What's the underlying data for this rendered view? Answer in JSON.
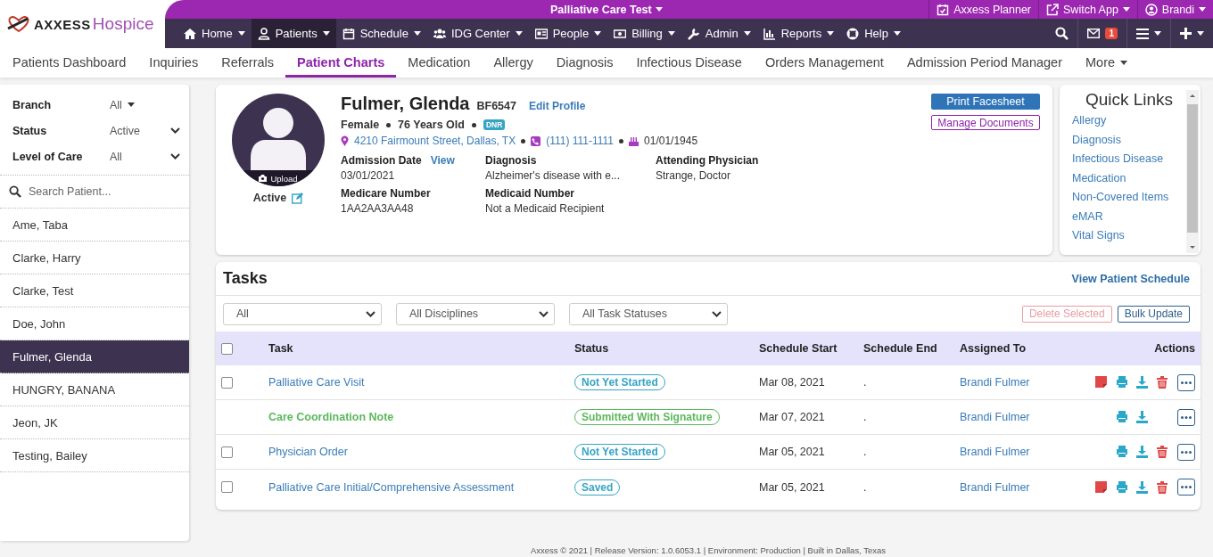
{
  "header": {
    "logo": {
      "brand": "AXXESS",
      "product": "Hospice"
    },
    "context_title": "Palliative Care Test",
    "top_links": [
      {
        "label": "Axxess Planner",
        "has_caret": false
      },
      {
        "label": "Switch App",
        "has_caret": true
      },
      {
        "label": "Brandi",
        "has_caret": true
      }
    ],
    "nav": [
      {
        "label": "Home",
        "selected": false
      },
      {
        "label": "Patients",
        "selected": true
      },
      {
        "label": "Schedule",
        "selected": false
      },
      {
        "label": "IDG Center",
        "selected": false
      },
      {
        "label": "People",
        "selected": false
      },
      {
        "label": "Billing",
        "selected": false
      },
      {
        "label": "Admin",
        "selected": false
      },
      {
        "label": "Reports",
        "selected": false
      },
      {
        "label": "Help",
        "selected": false
      }
    ],
    "message_count": "1"
  },
  "subnav": [
    {
      "label": "Patients Dashboard",
      "selected": false
    },
    {
      "label": "Inquiries",
      "selected": false
    },
    {
      "label": "Referrals",
      "selected": false
    },
    {
      "label": "Patient Charts",
      "selected": true
    },
    {
      "label": "Medication",
      "selected": false
    },
    {
      "label": "Allergy",
      "selected": false
    },
    {
      "label": "Diagnosis",
      "selected": false
    },
    {
      "label": "Infectious Disease",
      "selected": false
    },
    {
      "label": "Orders Management",
      "selected": false
    },
    {
      "label": "Admission Period Manager",
      "selected": false
    },
    {
      "label": "More",
      "selected": false
    }
  ],
  "sidebar": {
    "filters": [
      {
        "label": "Branch",
        "value": "All",
        "kind": "menu"
      },
      {
        "label": "Status",
        "value": "Active",
        "kind": "select"
      },
      {
        "label": "Level of Care",
        "value": "All",
        "kind": "select"
      }
    ],
    "search": {
      "placeholder": "Search Patient..."
    },
    "patients": [
      {
        "name": "Ame, Taba",
        "selected": false
      },
      {
        "name": "Clarke, Harry",
        "selected": false
      },
      {
        "name": "Clarke, Test",
        "selected": false
      },
      {
        "name": "Doe, John",
        "selected": false
      },
      {
        "name": "Fulmer, Glenda",
        "selected": true
      },
      {
        "name": "HUNGRY, BANANA",
        "selected": false
      },
      {
        "name": "Jeon, JK",
        "selected": false
      },
      {
        "name": "Testing, Bailey",
        "selected": false
      }
    ]
  },
  "patient": {
    "name": "Fulmer, Glenda",
    "id": "BF6547",
    "edit_link": "Edit Profile",
    "upload": "Upload",
    "status": "Active",
    "gender": "Female",
    "age": "76 Years Old",
    "badge": "DNR",
    "address": "4210 Fairmount Street, Dallas, TX",
    "phone": "(111) 111-1111",
    "birth_date": "01/01/1945",
    "fields": [
      {
        "label": "Admission Date",
        "value": "03/01/2021",
        "link": "View"
      },
      {
        "label": "Diagnosis",
        "value": "Alzheimer's disease with e..."
      },
      {
        "label": "Attending Physician",
        "value": "Strange, Doctor"
      },
      {
        "label": "Medicare Number",
        "value": "1AA2AA3AA48"
      },
      {
        "label": "Medicaid Number",
        "value": "Not a Medicaid Recipient"
      }
    ],
    "buttons": [
      {
        "label": "Print Facesheet",
        "kind": "primary"
      },
      {
        "label": "Manage Documents",
        "kind": "outline"
      }
    ]
  },
  "quick_links": {
    "title": "Quick Links",
    "links": [
      "Allergy",
      "Diagnosis",
      "Infectious Disease",
      "Medication",
      "Non-Covered Items",
      "eMAR",
      "Vital Signs"
    ]
  },
  "tasks": {
    "title": "Tasks",
    "schedule_link": "View Patient Schedule",
    "filters": [
      "All",
      "All Disciplines",
      "All Task Statuses"
    ],
    "buttons": [
      {
        "label": "Delete Selected",
        "disabled": true
      },
      {
        "label": "Bulk Update",
        "disabled": false
      }
    ],
    "select_all_checked": false,
    "columns": [
      "Task",
      "Status",
      "Schedule Start",
      "Schedule End",
      "Assigned To",
      "Actions"
    ],
    "rows": [
      {
        "task": "Palliative Care Visit",
        "kind": "open",
        "status": "Not Yet Started",
        "start": "Mar 08, 2021",
        "end": ".",
        "assigned": "Brandi Fulmer",
        "checked": false,
        "actions": [
          {
            "kind": "note"
          },
          {
            "kind": "print"
          },
          {
            "kind": "download"
          },
          {
            "kind": "delete"
          }
        ]
      },
      {
        "task": "Care Coordination Note",
        "kind": "completed",
        "status": "Submitted With Signature",
        "start": "Mar 07, 2021",
        "end": ".",
        "assigned": "Brandi Fulmer",
        "actions": [
          {
            "kind": "print"
          },
          {
            "kind": "download"
          }
        ]
      },
      {
        "task": "Physician Order",
        "kind": "open",
        "status": "Not Yet Started",
        "start": "Mar 05, 2021",
        "end": ".",
        "assigned": "Brandi Fulmer",
        "checked": false,
        "actions": [
          {
            "kind": "print"
          },
          {
            "kind": "download"
          },
          {
            "kind": "delete"
          }
        ]
      },
      {
        "task": "Palliative Care Initial/Comprehensive Assessment",
        "kind": "open",
        "status": "Saved",
        "start": "Mar 05, 2021",
        "end": ".",
        "assigned": "Brandi Fulmer",
        "checked": false,
        "actions": [
          {
            "kind": "note"
          },
          {
            "kind": "print"
          },
          {
            "kind": "download"
          },
          {
            "kind": "delete"
          }
        ]
      }
    ]
  },
  "footer": "Axxess © 2021 | Release Version: 1.0.6053.1 | Environment: Production | Built in Dallas, Texas"
}
